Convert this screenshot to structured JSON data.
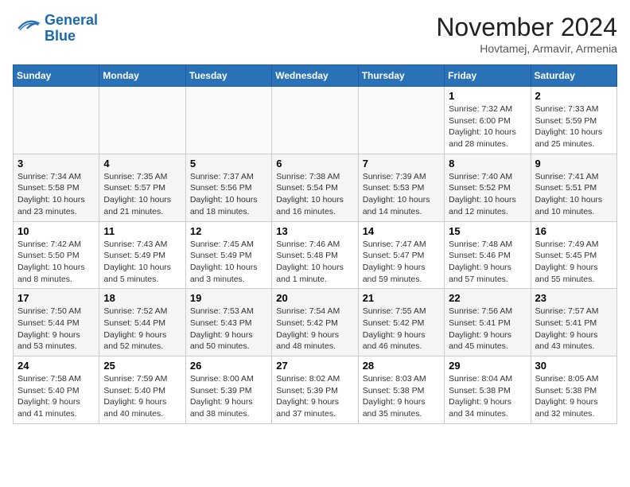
{
  "header": {
    "logo_line1": "General",
    "logo_line2": "Blue",
    "month": "November 2024",
    "location": "Hovtamej, Armavir, Armenia"
  },
  "weekdays": [
    "Sunday",
    "Monday",
    "Tuesday",
    "Wednesday",
    "Thursday",
    "Friday",
    "Saturday"
  ],
  "weeks": [
    [
      {
        "day": "",
        "info": ""
      },
      {
        "day": "",
        "info": ""
      },
      {
        "day": "",
        "info": ""
      },
      {
        "day": "",
        "info": ""
      },
      {
        "day": "",
        "info": ""
      },
      {
        "day": "1",
        "info": "Sunrise: 7:32 AM\nSunset: 6:00 PM\nDaylight: 10 hours and 28 minutes."
      },
      {
        "day": "2",
        "info": "Sunrise: 7:33 AM\nSunset: 5:59 PM\nDaylight: 10 hours and 25 minutes."
      }
    ],
    [
      {
        "day": "3",
        "info": "Sunrise: 7:34 AM\nSunset: 5:58 PM\nDaylight: 10 hours and 23 minutes."
      },
      {
        "day": "4",
        "info": "Sunrise: 7:35 AM\nSunset: 5:57 PM\nDaylight: 10 hours and 21 minutes."
      },
      {
        "day": "5",
        "info": "Sunrise: 7:37 AM\nSunset: 5:56 PM\nDaylight: 10 hours and 18 minutes."
      },
      {
        "day": "6",
        "info": "Sunrise: 7:38 AM\nSunset: 5:54 PM\nDaylight: 10 hours and 16 minutes."
      },
      {
        "day": "7",
        "info": "Sunrise: 7:39 AM\nSunset: 5:53 PM\nDaylight: 10 hours and 14 minutes."
      },
      {
        "day": "8",
        "info": "Sunrise: 7:40 AM\nSunset: 5:52 PM\nDaylight: 10 hours and 12 minutes."
      },
      {
        "day": "9",
        "info": "Sunrise: 7:41 AM\nSunset: 5:51 PM\nDaylight: 10 hours and 10 minutes."
      }
    ],
    [
      {
        "day": "10",
        "info": "Sunrise: 7:42 AM\nSunset: 5:50 PM\nDaylight: 10 hours and 8 minutes."
      },
      {
        "day": "11",
        "info": "Sunrise: 7:43 AM\nSunset: 5:49 PM\nDaylight: 10 hours and 5 minutes."
      },
      {
        "day": "12",
        "info": "Sunrise: 7:45 AM\nSunset: 5:49 PM\nDaylight: 10 hours and 3 minutes."
      },
      {
        "day": "13",
        "info": "Sunrise: 7:46 AM\nSunset: 5:48 PM\nDaylight: 10 hours and 1 minute."
      },
      {
        "day": "14",
        "info": "Sunrise: 7:47 AM\nSunset: 5:47 PM\nDaylight: 9 hours and 59 minutes."
      },
      {
        "day": "15",
        "info": "Sunrise: 7:48 AM\nSunset: 5:46 PM\nDaylight: 9 hours and 57 minutes."
      },
      {
        "day": "16",
        "info": "Sunrise: 7:49 AM\nSunset: 5:45 PM\nDaylight: 9 hours and 55 minutes."
      }
    ],
    [
      {
        "day": "17",
        "info": "Sunrise: 7:50 AM\nSunset: 5:44 PM\nDaylight: 9 hours and 53 minutes."
      },
      {
        "day": "18",
        "info": "Sunrise: 7:52 AM\nSunset: 5:44 PM\nDaylight: 9 hours and 52 minutes."
      },
      {
        "day": "19",
        "info": "Sunrise: 7:53 AM\nSunset: 5:43 PM\nDaylight: 9 hours and 50 minutes."
      },
      {
        "day": "20",
        "info": "Sunrise: 7:54 AM\nSunset: 5:42 PM\nDaylight: 9 hours and 48 minutes."
      },
      {
        "day": "21",
        "info": "Sunrise: 7:55 AM\nSunset: 5:42 PM\nDaylight: 9 hours and 46 minutes."
      },
      {
        "day": "22",
        "info": "Sunrise: 7:56 AM\nSunset: 5:41 PM\nDaylight: 9 hours and 45 minutes."
      },
      {
        "day": "23",
        "info": "Sunrise: 7:57 AM\nSunset: 5:41 PM\nDaylight: 9 hours and 43 minutes."
      }
    ],
    [
      {
        "day": "24",
        "info": "Sunrise: 7:58 AM\nSunset: 5:40 PM\nDaylight: 9 hours and 41 minutes."
      },
      {
        "day": "25",
        "info": "Sunrise: 7:59 AM\nSunset: 5:40 PM\nDaylight: 9 hours and 40 minutes."
      },
      {
        "day": "26",
        "info": "Sunrise: 8:00 AM\nSunset: 5:39 PM\nDaylight: 9 hours and 38 minutes."
      },
      {
        "day": "27",
        "info": "Sunrise: 8:02 AM\nSunset: 5:39 PM\nDaylight: 9 hours and 37 minutes."
      },
      {
        "day": "28",
        "info": "Sunrise: 8:03 AM\nSunset: 5:38 PM\nDaylight: 9 hours and 35 minutes."
      },
      {
        "day": "29",
        "info": "Sunrise: 8:04 AM\nSunset: 5:38 PM\nDaylight: 9 hours and 34 minutes."
      },
      {
        "day": "30",
        "info": "Sunrise: 8:05 AM\nSunset: 5:38 PM\nDaylight: 9 hours and 32 minutes."
      }
    ]
  ]
}
